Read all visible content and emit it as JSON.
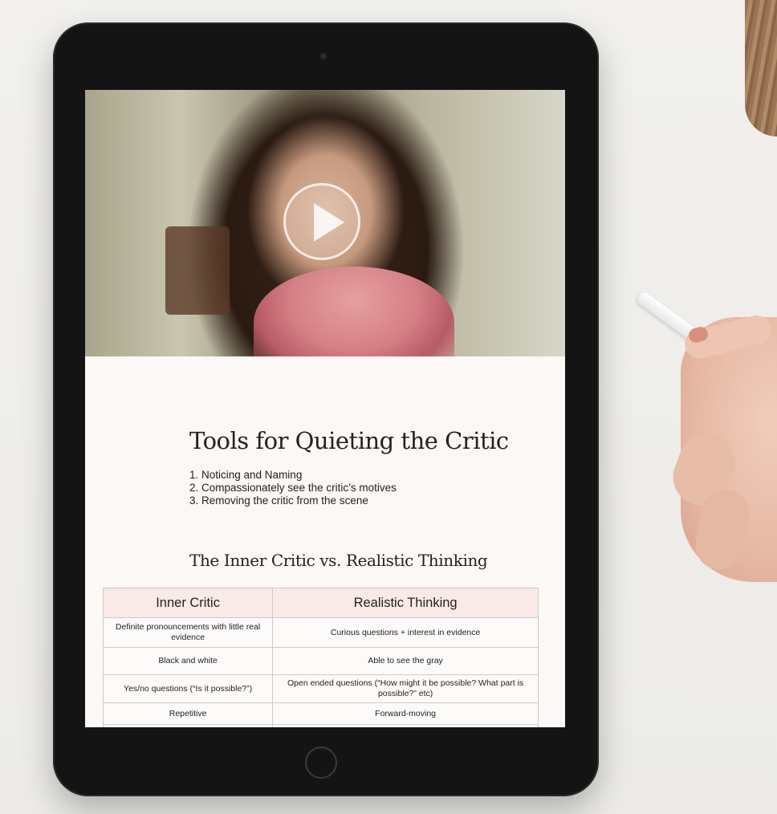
{
  "video": {
    "play_label": "Play video"
  },
  "lesson": {
    "title": "Tools for Quieting the Critic",
    "tools": [
      "1. Noticing and Naming",
      "2. Compassionately see the critic’s motives",
      "3. Removing the critic from the scene"
    ]
  },
  "comparison": {
    "title": "The Inner Critic vs. Realistic Thinking",
    "headers": [
      "Inner Critic",
      "Realistic Thinking"
    ],
    "rows": [
      [
        "Definite pronouncements with little real evidence",
        "Curious questions + interest in evidence"
      ],
      [
        "Black and white",
        "Able to see the gray"
      ],
      [
        "Yes/no questions (“Is it possible?”)",
        "Open ended questions (“How might it be possible? What part is possible?” etc)"
      ],
      [
        "Repetitive",
        "Forward-moving"
      ]
    ]
  },
  "colors": {
    "table_header_bg": "#f9e9e7",
    "screen_bg": "#fbf8f5",
    "tablet_frame": "#141414"
  }
}
